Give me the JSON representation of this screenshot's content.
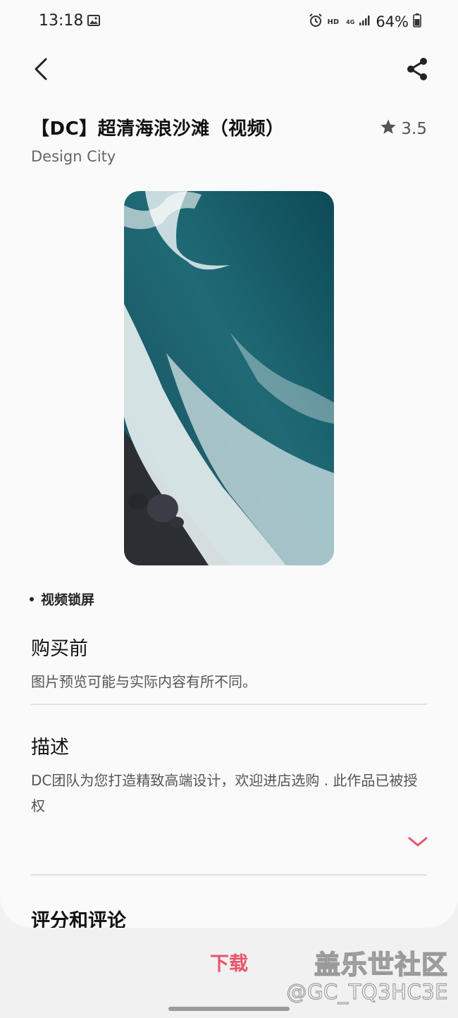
{
  "status_bar": {
    "time": "13:18",
    "hd": "HD",
    "network": "4G",
    "battery": "64%"
  },
  "product": {
    "title": "【DC】超清海浪沙滩（视频）",
    "rating": "3.5",
    "author": "Design City",
    "tag": "视频锁屏"
  },
  "sections": {
    "before_purchase_title": "购买前",
    "before_purchase_text": "图片预览可能与实际内容有所不同。",
    "description_title": "描述",
    "description_text": "DC团队为您打造精致高端设计，欢迎进店选购 . 此作品已被授权",
    "ratings_title": "评分和评论"
  },
  "actions": {
    "download_label": "下载"
  },
  "watermark": {
    "line1": "盖乐世社区",
    "line2": "@GC_TQ3HC3E"
  },
  "icons": {
    "back": "back-arrow-icon",
    "share": "share-icon",
    "star": "star-icon",
    "expand": "chevron-down-icon",
    "gallery": "image-icon",
    "alarm": "alarm-icon",
    "signal": "signal-icon",
    "battery": "battery-icon"
  },
  "colors": {
    "accent": "#e8546a",
    "background": "#fafafa",
    "bottom_bar": "#f1f1f1"
  }
}
